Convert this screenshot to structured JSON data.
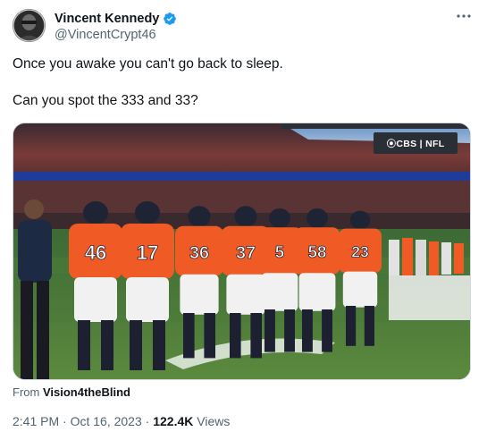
{
  "author": {
    "display_name": "Vincent Kennedy",
    "handle": "@VincentCrypt46",
    "verified": true,
    "avatar_icon": "avatar-photo"
  },
  "tweet": {
    "line1": "Once you awake you can't go back to sleep.",
    "line2": "Can you spot the 333 and 33?"
  },
  "media": {
    "scorebug": "⦿CBS | NFL",
    "jersey_numbers": [
      "46",
      "17",
      "36",
      "37",
      "5",
      "58",
      "23"
    ]
  },
  "source": {
    "prefix": "From ",
    "name": "Vision4theBlind"
  },
  "meta": {
    "time": "2:41 PM",
    "separator": " · ",
    "date": "Oct 16, 2023",
    "views_count": "122.4K",
    "views_label": " Views"
  },
  "colors": {
    "verified": "#1d9bf0",
    "secondary_text": "#536471",
    "primary_text": "#0f1419",
    "jersey_orange": "#f05a24"
  }
}
